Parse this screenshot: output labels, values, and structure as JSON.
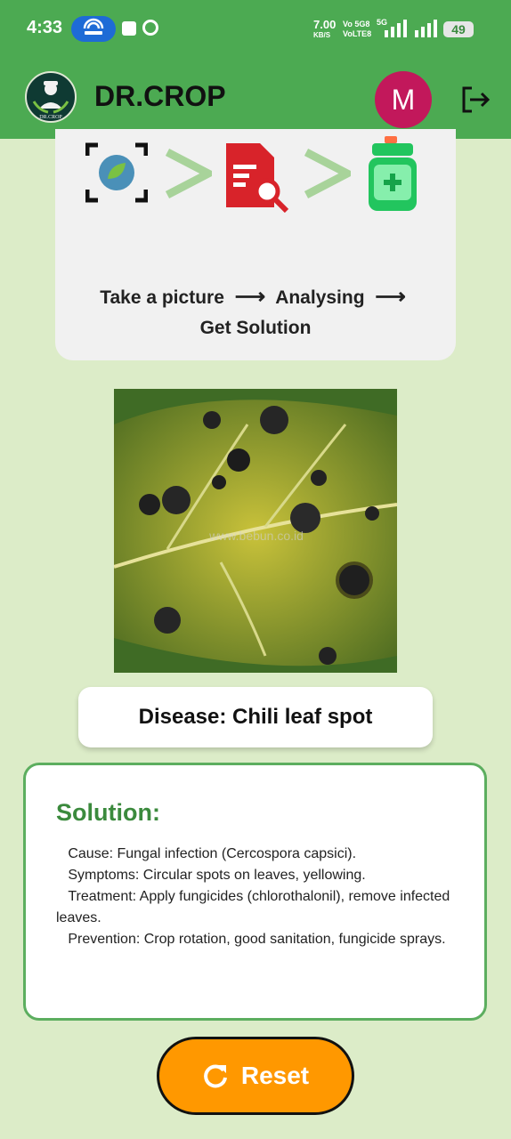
{
  "status_bar": {
    "time": "4:33",
    "net_speed": "7.00",
    "net_unit": "KB/S",
    "volte_top": "Vo 5G8",
    "volte_bottom": "VoLTE8",
    "gen": "5G",
    "battery": "49"
  },
  "app_bar": {
    "title": "DR.CROP",
    "logo_text": "DR.CROP",
    "avatar_initial": "M"
  },
  "steps": {
    "step1": "Take a picture",
    "step2": "Analysing",
    "step3": "Get Solution",
    "icons": [
      "scan-leaf-icon",
      "chevron-right-icon",
      "document-search-icon",
      "chevron-right-icon",
      "medicine-bottle-icon"
    ]
  },
  "image": {
    "watermark": "www.bebun.co.id"
  },
  "result": {
    "disease_label": "Disease: Chili leaf spot"
  },
  "solution": {
    "title": "Solution:",
    "body": "   Cause: Fungal infection (Cercospora capsici).\n   Symptoms: Circular spots on leaves, yellowing.\n   Treatment: Apply fungicides (chlorothalonil), remove infected leaves.\n   Prevention: Crop rotation, good sanitation, fungicide sprays."
  },
  "actions": {
    "reset_label": "Reset"
  },
  "colors": {
    "app_bar": "#4caa52",
    "background": "#dcecc8",
    "accent": "#ff9800",
    "avatar": "#c2185b",
    "solution_title": "#3b8a3d"
  }
}
